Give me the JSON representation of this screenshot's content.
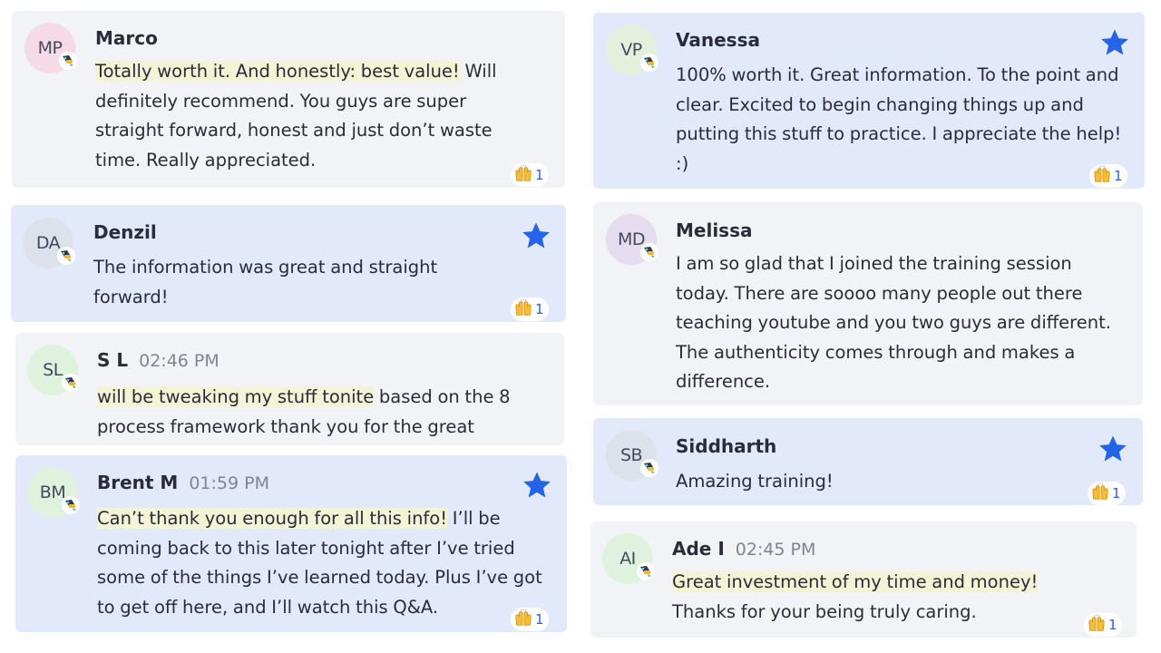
{
  "colors": {
    "card_default": "#f2f3f6",
    "card_starred": "#e1e9fb",
    "star": "#2563e8",
    "highlight": "#f3f3d6",
    "reaction_count": "#2f5fd8"
  },
  "messages": [
    {
      "initials": "MP",
      "avatar_color": "#f5dbe6",
      "name": "Marco",
      "time": "",
      "highlight": "Totally worth it. And honestly: best value!",
      "text": " Will definitely recommend. You guys are super straight forward, honest and just don’t waste time. Really appreciated.",
      "starred": false,
      "reaction_icon": "raising-hands-icon",
      "reaction_count": "1"
    },
    {
      "initials": "DA",
      "avatar_color": "#dde1ea",
      "name": "Denzil",
      "time": "",
      "highlight": "",
      "text": "The information was great and straight forward!",
      "starred": true,
      "reaction_icon": "raising-hands-icon",
      "reaction_count": "1"
    },
    {
      "initials": "SL",
      "avatar_color": "#dff2de",
      "name": "S L",
      "time": "02:46 PM",
      "highlight": "will be tweaking my stuff tonite",
      "text": " based on the 8 process framework thank you for the great",
      "starred": false,
      "reaction_icon": "",
      "reaction_count": ""
    },
    {
      "initials": "BM",
      "avatar_color": "#dff2de",
      "name": "Brent M",
      "time": "01:59 PM",
      "highlight": "Can’t thank you enough for all this info!",
      "text": " I’ll be coming back to this later tonight after I’ve tried some of the things I’ve learned today. Plus I’ve got to get off here, and I’ll watch this Q&A.",
      "starred": true,
      "reaction_icon": "raising-hands-icon",
      "reaction_count": "1"
    },
    {
      "initials": "VP",
      "avatar_color": "#e3f1dc",
      "name": "Vanessa",
      "time": "",
      "highlight": "",
      "text": "100% worth it. Great information. To the point and clear. Excited to begin changing things up and putting this stuff to practice. I appreciate the help! :)",
      "starred": true,
      "reaction_icon": "raising-hands-icon",
      "reaction_count": "1"
    },
    {
      "initials": "MD",
      "avatar_color": "#e5dcf0",
      "name": "Melissa",
      "time": "",
      "highlight": "",
      "text": "I am so glad that I joined the training session today. There are soooo many people out there teaching youtube and you two guys are different. The authenticity comes through and makes a difference.",
      "starred": false,
      "reaction_icon": "",
      "reaction_count": ""
    },
    {
      "initials": "SB",
      "avatar_color": "#dde1ea",
      "name": "Siddharth",
      "time": "",
      "highlight": "",
      "text": "Amazing training!",
      "starred": true,
      "reaction_icon": "raising-hands-icon",
      "reaction_count": "1"
    },
    {
      "initials": "AI",
      "avatar_color": "#dff2de",
      "name": "Ade I",
      "time": "02:45 PM",
      "highlight": "Great investment of my time and money!",
      "text": " Thanks for your being truly caring.",
      "starred": false,
      "reaction_icon": "raising-hands-icon",
      "reaction_count": "1"
    }
  ]
}
